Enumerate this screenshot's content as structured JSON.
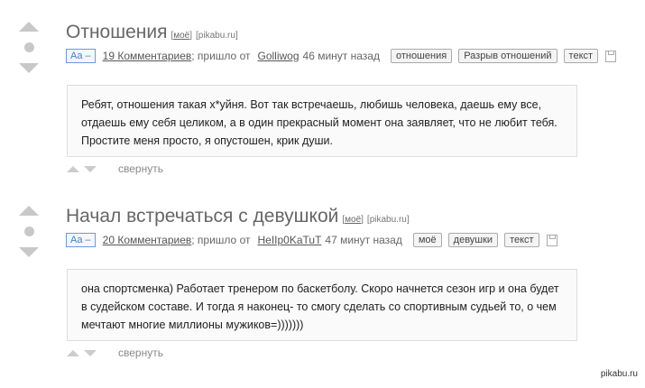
{
  "posts": [
    {
      "title": "Отношения",
      "meta_link1": "моё",
      "meta_link2": "[pikabu.ru]",
      "font_toggle": "Aa –",
      "comments": "19 Комментариев",
      "came_from": "; пришло от",
      "author": "Golliwog",
      "time": "46 минут назад",
      "tags": [
        "отношения",
        "Разрыв отношений",
        "текст"
      ],
      "content": "Ребят, отношения такая х*уйня. Вот так встречаешь, любишь человека, даешь ему все, отдаешь ему себя целиком, а в один прекрасный момент она заявляет, что не любит тебя. Простите меня просто, я опустошен, крик души.",
      "collapse": "свернуть"
    },
    {
      "title": "Начал встречаться с девушкой",
      "meta_link1": "моё",
      "meta_link2": "[pikabu.ru]",
      "font_toggle": "Aa –",
      "comments": "20 Комментариев",
      "came_from": "; пришло от",
      "author": "HeIIp0KaTuT",
      "time": "47 минут назад",
      "tags": [
        "моё",
        "девушки",
        "текст"
      ],
      "content": "она спортсменка) Работает тренером по баскетболу. Скоро начнется сезон игр и она будет в судейском составе. И тогда я наконец- то смогу сделать со спортивным судьей то, о чем мечтают многие миллионы мужиков=)))))))",
      "collapse": "свернуть"
    }
  ],
  "watermark": "pikabu.ru"
}
